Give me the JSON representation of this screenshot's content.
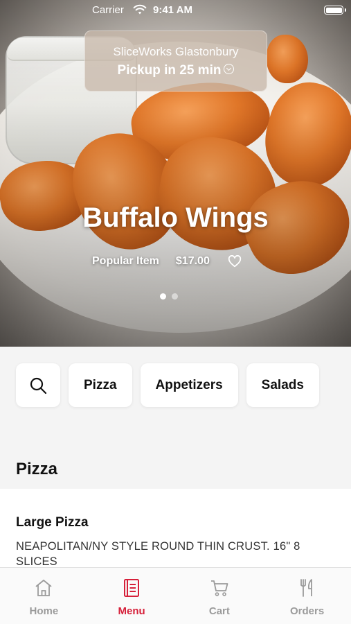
{
  "status_bar": {
    "carrier": "Carrier",
    "time": "9:41 AM"
  },
  "location": {
    "name": "SliceWorks Glastonbury",
    "pickup": "Pickup in 25 min"
  },
  "hero": {
    "title": "Buffalo Wings",
    "badge": "Popular Item",
    "price": "$17.00",
    "slides": 2,
    "active_slide": 1
  },
  "categories": [
    {
      "label": "Pizza"
    },
    {
      "label": "Appetizers"
    },
    {
      "label": "Salads"
    }
  ],
  "section": {
    "title": "Pizza"
  },
  "items": [
    {
      "name": "Large Pizza",
      "description": "NEAPOLITAN/NY STYLE ROUND THIN CRUST. 16\" 8 SLICES"
    }
  ],
  "tabs": [
    {
      "label": "Home",
      "icon": "home-icon"
    },
    {
      "label": "Menu",
      "icon": "menu-icon",
      "active": true
    },
    {
      "label": "Cart",
      "icon": "cart-icon"
    },
    {
      "label": "Orders",
      "icon": "orders-icon"
    }
  ],
  "colors": {
    "accent": "#d6203a",
    "tab_inactive": "#9a9a9a"
  }
}
